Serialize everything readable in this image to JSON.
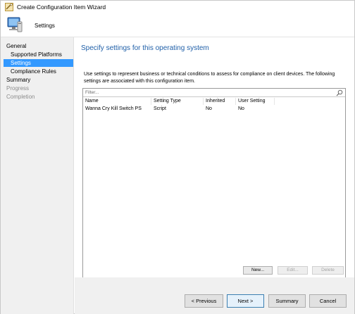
{
  "window": {
    "title": "Create Configuration Item Wizard"
  },
  "banner": {
    "label": "Settings"
  },
  "nav": {
    "items": [
      {
        "label": "General",
        "state": "normal"
      },
      {
        "label": "Supported Platforms",
        "state": "normal"
      },
      {
        "label": "Settings",
        "state": "active"
      },
      {
        "label": "Compliance Rules",
        "state": "normal"
      },
      {
        "label": "Summary",
        "state": "normal"
      },
      {
        "label": "Progress",
        "state": "disabled"
      },
      {
        "label": "Completion",
        "state": "disabled"
      }
    ]
  },
  "main": {
    "heading": "Specify settings for this operating system",
    "description": "Use settings to represent business or technical conditions to assess for compliance on client devices. The following settings are associated with this configuration item.",
    "filter": {
      "placeholder": "Filter..."
    },
    "table": {
      "columns": [
        "Name",
        "Setting Type",
        "Inherited",
        "User Setting"
      ],
      "rows": [
        [
          "Wanna Cry Kill Switch PS",
          "Script",
          "No",
          "No"
        ]
      ]
    },
    "buttons": {
      "new": "New...",
      "edit": "Edit...",
      "delete": "Delete"
    }
  },
  "footer": {
    "previous": "< Previous",
    "next": "Next >",
    "summary": "Summary",
    "cancel": "Cancel"
  },
  "colors": {
    "accent": "#3399ff",
    "heading": "#1f5fa8",
    "nav_bg": "#f0f0f0"
  }
}
